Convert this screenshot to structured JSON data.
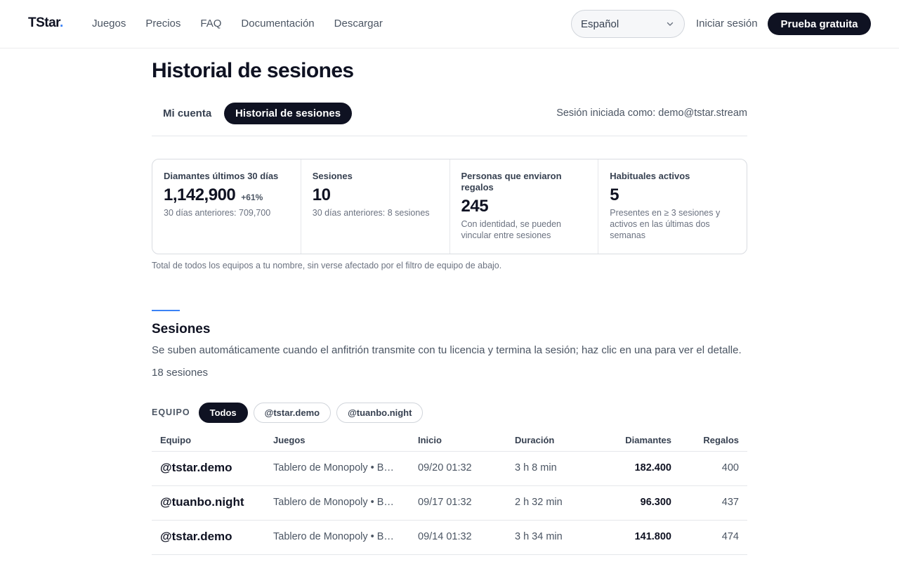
{
  "nav": {
    "logo_main": "TStar",
    "logo_dot": ".",
    "links": [
      "Juegos",
      "Precios",
      "FAQ",
      "Documentación",
      "Descargar"
    ],
    "language": "Español",
    "login": "Iniciar sesión",
    "trial": "Prueba gratuita"
  },
  "page": {
    "title": "Historial de sesiones",
    "tabs": [
      "Mi cuenta",
      "Historial de sesiones"
    ],
    "active_tab": "Historial de sesiones",
    "logged_in_as": "Sesión iniciada como: demo@tstar.stream"
  },
  "stats": [
    {
      "label": "Diamantes últimos 30 días",
      "value": "1,142,900",
      "delta": "+61%",
      "sub": "30 días anteriores: 709,700"
    },
    {
      "label": "Sesiones",
      "value": "10",
      "delta": "",
      "sub": "30 días anteriores: 8 sesiones"
    },
    {
      "label": "Personas que enviaron regalos",
      "value": "245",
      "delta": "",
      "sub": "Con identidad, se pueden vincular entre sesiones"
    },
    {
      "label": "Habituales activos",
      "value": "5",
      "delta": "",
      "sub": "Presentes en ≥ 3 sesiones y activos en las últimas dos semanas"
    }
  ],
  "stats_note": "Total de todos los equipos a tu nombre, sin verse afectado por el filtro de equipo de abajo.",
  "sessions": {
    "title": "Sesiones",
    "description": "Se suben automáticamente cuando el anfitrión transmite con tu licencia y termina la sesión; haz clic en una para ver el detalle.",
    "count": "18 sesiones",
    "filter_label": "EQUIPO",
    "filters": [
      "Todos",
      "@tstar.demo",
      "@tuanbo.night"
    ],
    "active_filter": "Todos",
    "columns": [
      "Equipo",
      "Juegos",
      "Inicio",
      "Duración",
      "Diamantes",
      "Regalos"
    ],
    "rows": [
      {
        "team": "@tstar.demo",
        "games": "Tablero de Monopoly  •  B…",
        "start": "09/20 01:32",
        "duration": "3 h 8 min",
        "diamonds": "182.400",
        "gifts": "400"
      },
      {
        "team": "@tuanbo.night",
        "games": "Tablero de Monopoly  •  B…",
        "start": "09/17 01:32",
        "duration": "2 h 32 min",
        "diamonds": "96.300",
        "gifts": "437"
      },
      {
        "team": "@tstar.demo",
        "games": "Tablero de Monopoly  •  B…",
        "start": "09/14 01:32",
        "duration": "3 h 34 min",
        "diamonds": "141.800",
        "gifts": "474"
      }
    ]
  }
}
